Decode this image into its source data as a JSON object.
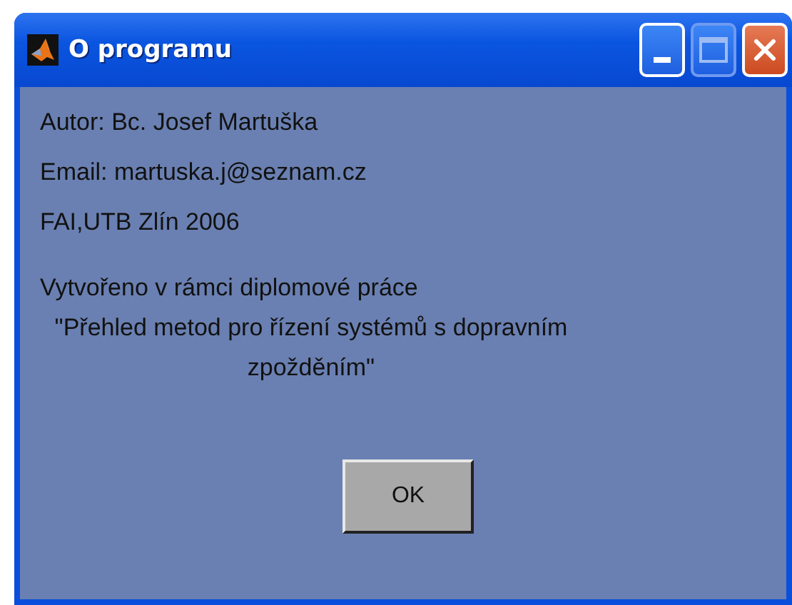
{
  "window": {
    "title": "O programu"
  },
  "lines": [
    "Autor: Bc. Josef Martuška",
    "Email: martuska.j@seznam.cz",
    "FAI,UTB Zlín 2006"
  ],
  "description": {
    "intro": "Vytvořeno v rámci diplomové práce",
    "thesis_title": "\"Přehled metod pro řízení systémů s dopravním zpožděním\""
  },
  "buttons": [
    "OK"
  ]
}
